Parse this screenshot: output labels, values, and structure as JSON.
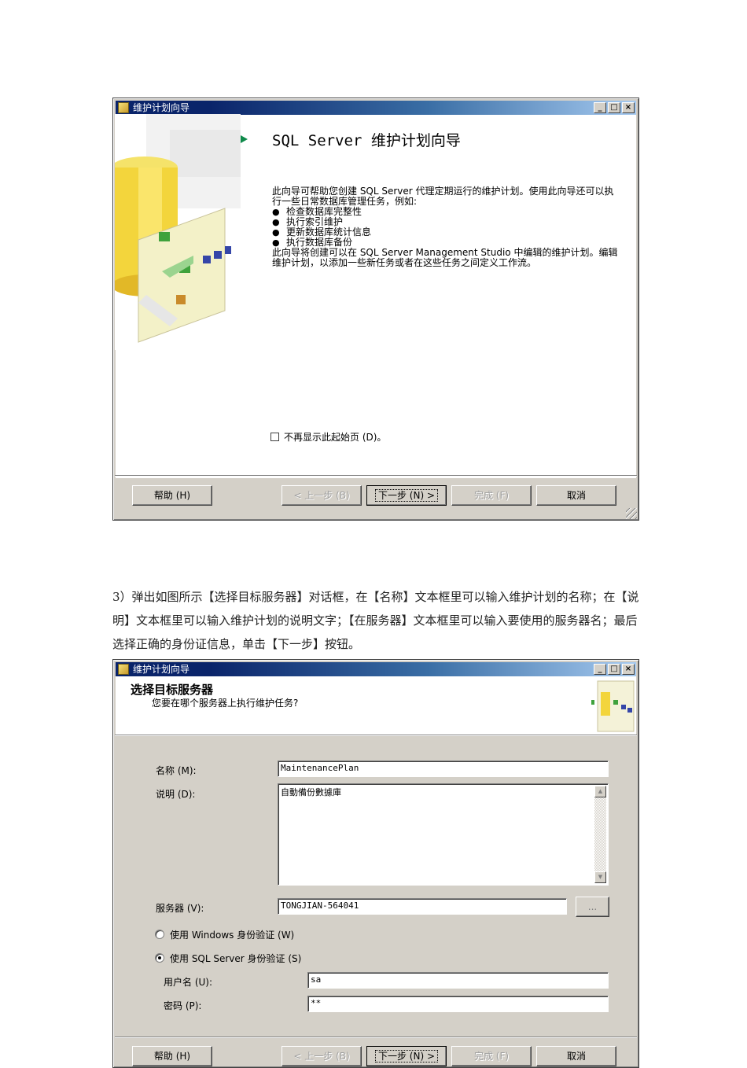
{
  "dialog1": {
    "title": "维护计划向导",
    "heading": "SQL Server 维护计划向导",
    "intro_line1": "此向导可帮助您创建 SQL Server 代理定期运行的维护计划。使用此向导还可以执行一些日常数据库管理任务，例如:",
    "bullets": [
      "检查数据库完整性",
      "执行索引维护",
      "更新数据库统计信息",
      "执行数据库备份"
    ],
    "intro_line2": "此向导将创建可以在 SQL Server Management Studio 中编辑的维护计划。编辑维护计划，以添加一些新任务或者在这些任务之间定义工作流。",
    "checkbox_label": "不再显示此起始页 (D)。",
    "buttons": {
      "help": "帮助 (H)",
      "back": "< 上一步 (B)",
      "next": "下一步 (N) >",
      "finish": "完成 (F)",
      "cancel": "取消"
    }
  },
  "paragraph": "3）弹出如图所示【选择目标服务器】对话框，在【名称】文本框里可以输入维护计划的名称；在【说明】文本框里可以输入维护计划的说明文字；【在服务器】文本框里可以输入要使用的服务器名；最后选择正确的身份证信息，单击【下一步】按钮。",
  "dialog2": {
    "title": "维护计划向导",
    "header_title": "选择目标服务器",
    "header_subtitle": "您要在哪个服务器上执行维护任务?",
    "name_label": "名称 (M):",
    "name_value": "MaintenancePlan",
    "desc_label": "说明 (D):",
    "desc_value": "自動備份數據庫",
    "server_label": "服务器 (V):",
    "server_value": "TONGJIAN-564041",
    "browse_label": "...",
    "radio_windows": "使用 Windows 身份验证 (W)",
    "radio_sql": "使用 SQL Server 身份验证 (S)",
    "user_label": "用户名 (U):",
    "user_value": "sa",
    "password_label": "密码 (P):",
    "password_value": "**",
    "buttons": {
      "help": "帮助 (H)",
      "back": "< 上一步 (B)",
      "next": "下一步 (N) >",
      "finish": "完成 (F)",
      "cancel": "取消"
    }
  },
  "window_controls": [
    "_",
    "□",
    "×"
  ]
}
